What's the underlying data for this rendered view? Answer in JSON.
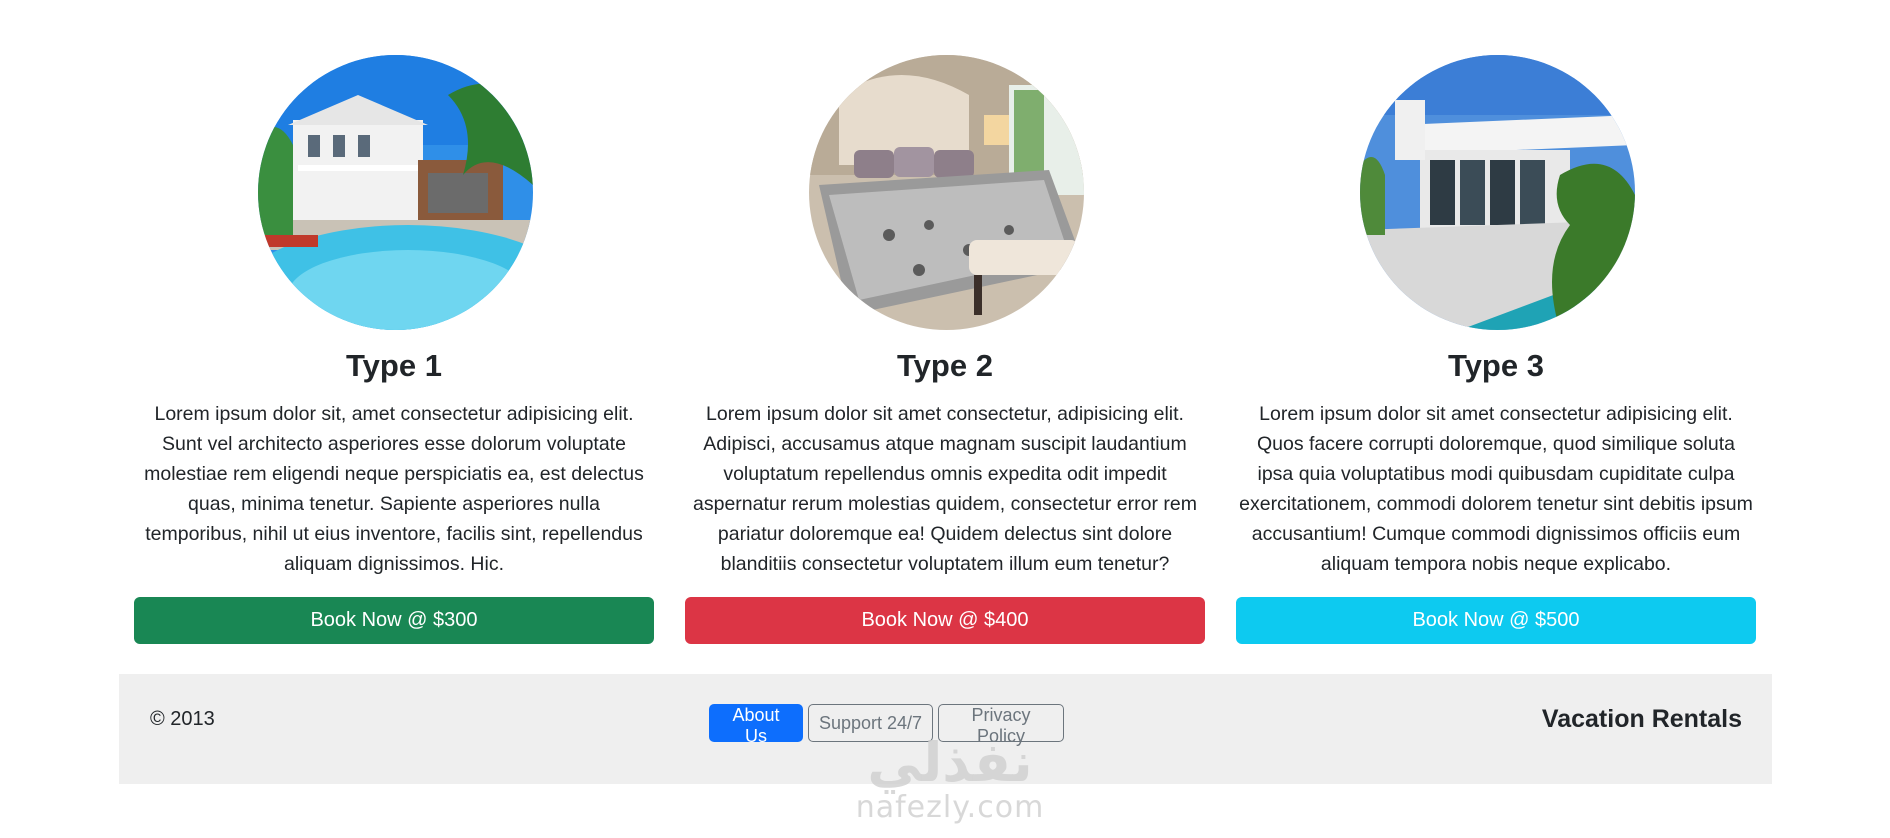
{
  "cards": [
    {
      "title": "Type 1",
      "text": "Lorem ipsum dolor sit, amet consectetur adipisicing elit. Sunt vel architecto asperiores esse dolorum voluptate molestiae rem eligendi neque perspiciatis ea, est delectus quas, minima tenetur. Sapiente asperiores nulla temporibus, nihil ut eius inventore, facilis sint, repellendus aliquam dignissimos. Hic.",
      "button_label": "Book Now @ $300",
      "button_color": "#198754",
      "image": "house-with-pool-photo"
    },
    {
      "title": "Type 2",
      "text": "Lorem ipsum dolor sit amet consectetur, adipisicing elit. Adipisci, accusamus atque magnam suscipit laudantium voluptatum repellendus omnis expedita odit impedit aspernatur rerum molestias quidem, consectetur error rem pariatur doloremque ea! Quidem delectus sint dolore blanditiis consectetur voluptatem illum eum tenetur?",
      "button_label": "Book Now @ $400",
      "button_color": "#dc3545",
      "image": "bedroom-photo"
    },
    {
      "title": "Type 3",
      "text": "Lorem ipsum dolor sit amet consectetur adipisicing elit. Quos facere corrupti doloremque, quod similique soluta ipsa quia voluptatibus modi quibusdam cupiditate culpa exercitationem, commodi dolorem tenetur sint debitis ipsum accusantium! Cumque commodi dignissimos officiis eum aliquam tempora nobis neque explicabo.",
      "button_label": "Book Now @ $500",
      "button_color": "#0dcaf0",
      "image": "modern-villa-photo"
    }
  ],
  "footer": {
    "copyright": "© 2013",
    "nav": {
      "about": "About Us",
      "support": "Support 24/7",
      "privacy": "Privacy Policy"
    },
    "brand": "Vacation Rentals",
    "background": "#efefef",
    "active_color": "#0d6efd"
  },
  "watermark": {
    "arabic": "نفذلي",
    "latin": "nafezly.com"
  }
}
